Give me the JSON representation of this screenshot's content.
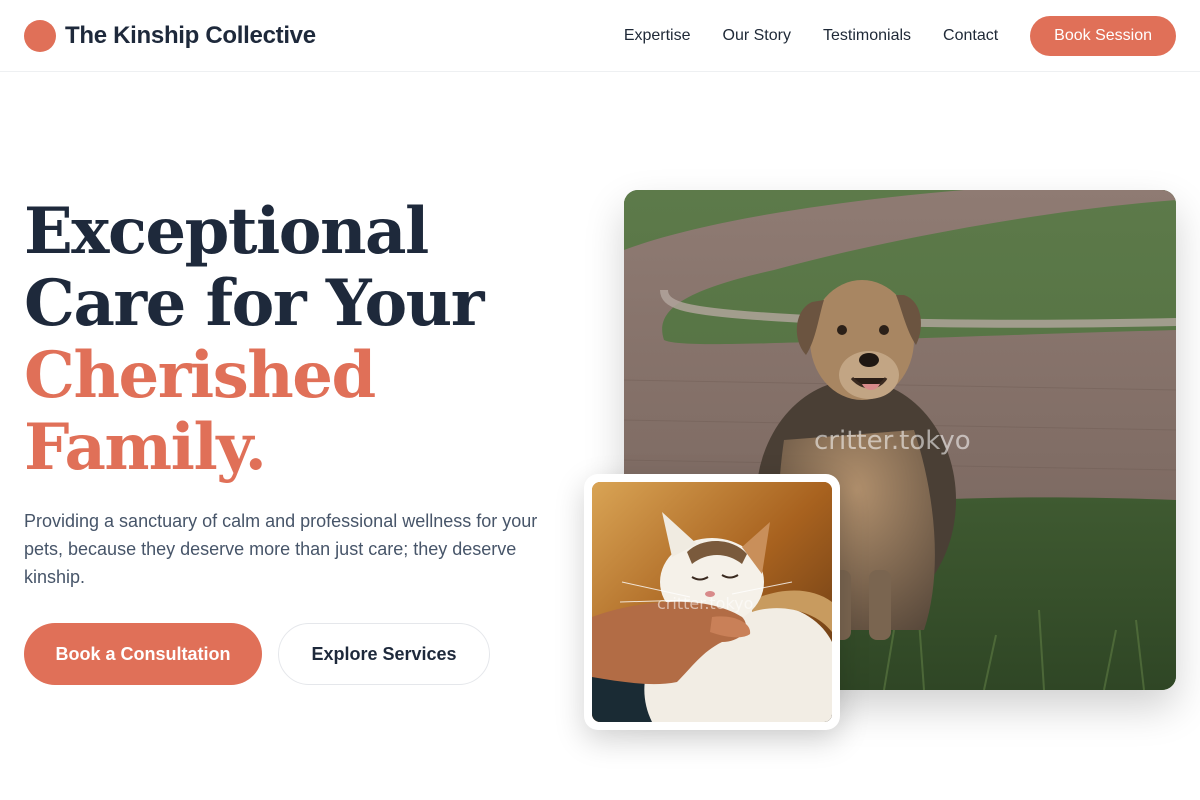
{
  "brand": {
    "name": "The Kinship Collective",
    "accent": "#e07058"
  },
  "nav": {
    "links": [
      "Expertise",
      "Our Story",
      "Testimonials",
      "Contact"
    ],
    "cta_label": "Book Session"
  },
  "hero": {
    "title_lines": [
      "Exceptional",
      "Care for Your"
    ],
    "title_accent_lines": [
      "Cherished",
      "Family."
    ],
    "subtitle": "Providing a sanctuary of calm and professional wellness for your pets, because they deserve more than just care; they deserve kinship.",
    "primary_cta": "Book a Consultation",
    "secondary_cta": "Explore Services"
  },
  "images": {
    "main": {
      "subject": "dog",
      "watermark": "critter.tokyo"
    },
    "inset": {
      "subject": "cat",
      "watermark": "critter.tokyo"
    }
  },
  "colors": {
    "dark_text": "#1e293b",
    "body_text": "#475569",
    "accent": "#e07058"
  }
}
